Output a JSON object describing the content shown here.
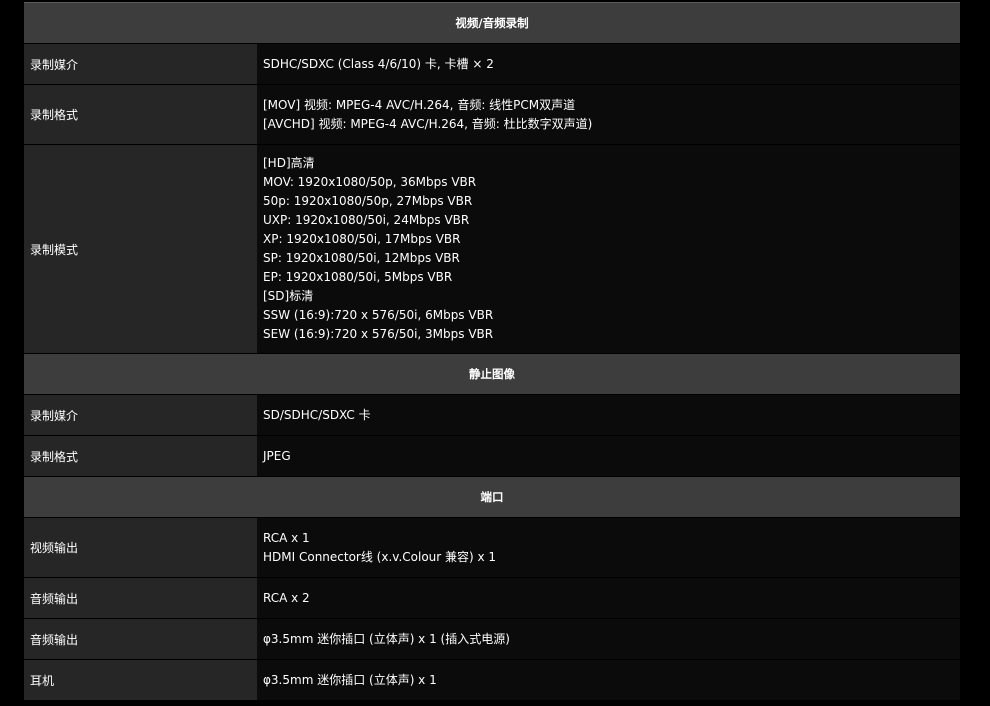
{
  "sections": [
    {
      "title": "视频/音频录制",
      "rows": [
        {
          "label": "录制媒介",
          "lines": [
            "SDHC/SDXC (Class 4/6/10) 卡, 卡槽 × 2"
          ]
        },
        {
          "label": "录制格式",
          "lines": [
            "[MOV] 视频: MPEG-4 AVC/H.264, 音频: 线性PCM双声道",
            "[AVCHD] 视频: MPEG-4 AVC/H.264, 音频: 杜比数字双声道)"
          ]
        },
        {
          "label": "录制模式",
          "lines": [
            "[HD]高清",
            "MOV: 1920x1080/50p, 36Mbps VBR",
            "50p: 1920x1080/50p, 27Mbps VBR",
            "UXP: 1920x1080/50i, 24Mbps VBR",
            "XP: 1920x1080/50i, 17Mbps VBR",
            "SP: 1920x1080/50i, 12Mbps VBR",
            "EP: 1920x1080/50i, 5Mbps VBR",
            "[SD]标清",
            "SSW (16:9):720 x 576/50i, 6Mbps VBR",
            "SEW (16:9):720 x 576/50i, 3Mbps VBR"
          ]
        }
      ]
    },
    {
      "title": "静止图像",
      "rows": [
        {
          "label": "录制媒介",
          "lines": [
            "SD/SDHC/SDXC 卡"
          ]
        },
        {
          "label": "录制格式",
          "lines": [
            "JPEG"
          ]
        }
      ]
    },
    {
      "title": "端口",
      "rows": [
        {
          "label": "视频输出",
          "lines": [
            "RCA x 1",
            "HDMI Connector线 (x.v.Colour 兼容) x 1"
          ]
        },
        {
          "label": "音频输出",
          "lines": [
            "RCA x 2"
          ]
        },
        {
          "label": "音频输出",
          "lines": [
            "φ3.5mm 迷你插口 (立体声) x 1 (插入式电源)"
          ]
        },
        {
          "label": "耳机",
          "lines": [
            "φ3.5mm 迷你插口 (立体声) x 1"
          ]
        }
      ]
    }
  ]
}
